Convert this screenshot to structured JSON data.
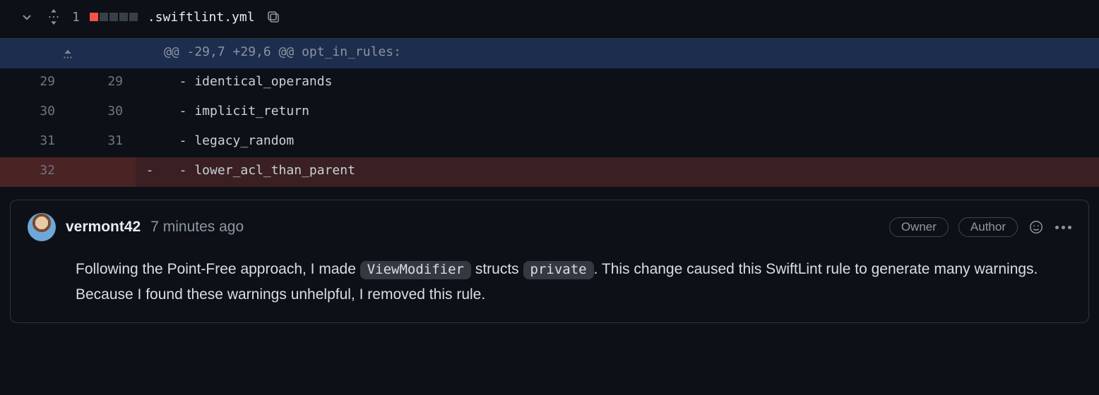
{
  "file": {
    "change_count": "1",
    "name": ".swiftlint.yml",
    "diffstat": {
      "removed": 1,
      "total": 5
    }
  },
  "hunk": {
    "header": "@@ -29,7 +29,6 @@ opt_in_rules:"
  },
  "lines": [
    {
      "old": "29",
      "new": "29",
      "sign": "",
      "text": "  - identical_operands",
      "type": "ctx"
    },
    {
      "old": "30",
      "new": "30",
      "sign": "",
      "text": "  - implicit_return",
      "type": "ctx"
    },
    {
      "old": "31",
      "new": "31",
      "sign": "",
      "text": "  - legacy_random",
      "type": "ctx"
    },
    {
      "old": "32",
      "new": "",
      "sign": "-",
      "text": "  - lower_acl_than_parent",
      "type": "del"
    }
  ],
  "comment": {
    "user": "vermont42",
    "time": "7 minutes ago",
    "badges": [
      "Owner",
      "Author"
    ],
    "body_pre": "Following the Point-Free approach, I made ",
    "code1": "ViewModifier",
    "body_mid": " structs ",
    "code2": "private",
    "body_post": ". This change caused this SwiftLint rule to generate many warnings. Because I found these warnings unhelpful, I removed this rule."
  }
}
